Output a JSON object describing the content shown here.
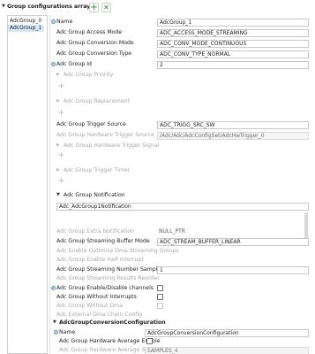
{
  "header": {
    "title": "Group configurations array",
    "add_label": "+",
    "remove_label": "✕"
  },
  "group_list": [
    {
      "label": "AdcGroup_0"
    },
    {
      "label": "AdcGroup_1"
    }
  ],
  "fields": {
    "name": {
      "label": "Name",
      "value": "AdcGroup_1"
    },
    "access_mode": {
      "label": "Adc Group Access Mode",
      "value": "ADC_ACCESS_MODE_STREAMING"
    },
    "conversion_mode": {
      "label": "Adc Group Conversion Mode",
      "value": "ADC_CONV_MODE_CONTINUOUS"
    },
    "conversion_type": {
      "label": "Adc Group Conversion Type",
      "value": "ADC_CONV_TYPE_NORMAL"
    },
    "group_id": {
      "label": "Adc Group Id",
      "value": "2"
    },
    "priority": {
      "label": "Adc Group Priority"
    },
    "replacement": {
      "label": "Adc Group Replacement"
    },
    "trigger_source": {
      "label": "Adc Group Trigger Source",
      "value": "ADC_TRIGG_SRC_SW"
    },
    "hw_trigger_source": {
      "label": "Adc Group Hardware Trigger Source",
      "value": "/Adc/Adc/AdcConfigSet/AdcHwTrigger_0"
    },
    "hw_trigger_signal": {
      "label": "Adc Group Hardware Trigger Signal"
    },
    "trigger_timer": {
      "label": "Adc Group Trigger Timer"
    },
    "notification": {
      "label": "Adc Group Notification",
      "value": "Adc_AdcGroup1Notification"
    },
    "extra_notification": {
      "label": "Adc Group Extra Notification",
      "value": "NULL_PTR"
    },
    "buffer_mode": {
      "label": "Adc Group Streaming Buffer Mode",
      "value": "ADC_STREAM_BUFFER_LINEAR"
    },
    "optimize_dma": {
      "label": "Adc Enable Optimize Dma Streaming Groups"
    },
    "half_interrupt": {
      "label": "Adc Group Enable Half Interrupt"
    },
    "num_samples": {
      "label": "Adc Group Streaming Number Samples",
      "value": "1"
    },
    "results_reorder": {
      "label": "Adc Group Streaming Results Reorder"
    },
    "enable_disable": {
      "label": "Adc Group Enable/Disable channels"
    },
    "without_interrupts": {
      "label": "Adc Group Without Interrupts"
    },
    "without_dma": {
      "label": "Adc Group Without Dma"
    },
    "ext_dma_chain": {
      "label": "Adc External Dma Chain Config"
    }
  },
  "conv_config": {
    "section_label": "AdcGroupConversionConfiguration",
    "name": {
      "label": "Name",
      "value": "AdcGroupConversionConfiguration"
    },
    "hw_avg_enable": {
      "label": "Adc Group Hardware Average Enable"
    },
    "hw_avg_select": {
      "label": "Adc Group Hardware Average Select",
      "value": "SAMPLES_4"
    }
  },
  "colors": {
    "selection": "#d6e7f7",
    "add_green": "#2e8b2e",
    "disabled_text": "#a8a8a8",
    "info_icon": "#b8d4ec"
  }
}
